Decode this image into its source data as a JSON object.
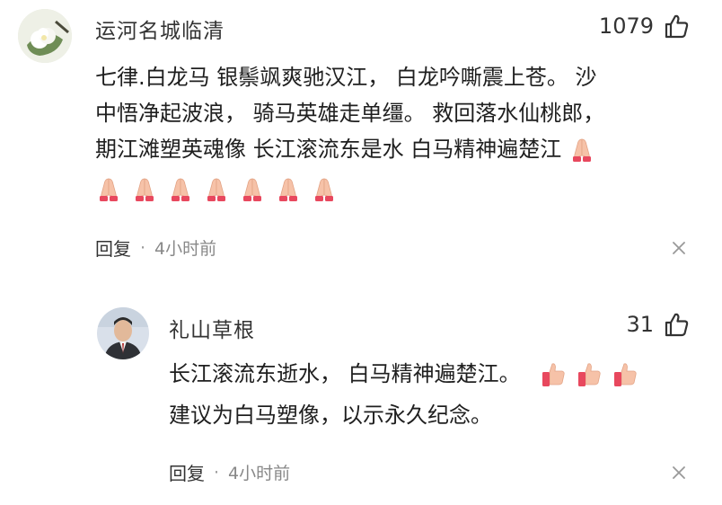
{
  "comment": {
    "username": "运河名城临清",
    "likes": "1079",
    "lines": [
      "七律.白龙马 银鬃飒爽驰汉江， 白龙吟嘶震上苍。 沙",
      "中悟净起波浪， 骑马英雄走单缰。 救回落水仙桃郎，",
      "期江滩塑英魂像 长江滚流东是水 白马精神遍楚江"
    ],
    "reply_label": "回复",
    "separator": "·",
    "time": "4小时前"
  },
  "reply": {
    "username": "礼山草根",
    "likes": "31",
    "lines": [
      "长江滚流东逝水， 白马精神遍楚江。",
      "建议为白马塑像，以示永久纪念。"
    ],
    "reply_label": "回复",
    "separator": "·",
    "time": "4小时前"
  },
  "icons": {
    "like": "thumbs-up-icon",
    "close": "close-icon",
    "pray": "folded-hands-emoji",
    "thumbs": "thumbs-up-emoji"
  },
  "colors": {
    "text": "#1f1f1f",
    "meta": "#888888",
    "skin": "#f6c2a8",
    "sleeve": "#e8485e"
  }
}
